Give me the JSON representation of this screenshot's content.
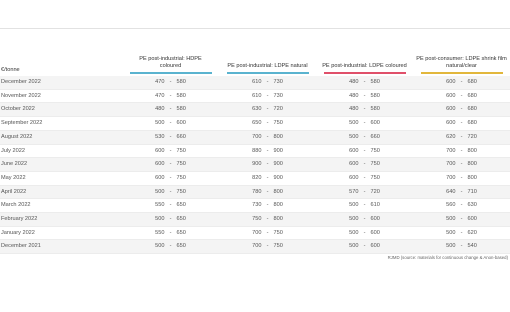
{
  "header_first": "€/tonne",
  "columns": [
    {
      "line1": "PE post-industrial: HDPE",
      "line2": "coloured",
      "color": "#5ab3cf"
    },
    {
      "line1": "PE post-industrial: LDPE natural",
      "line2": "",
      "color": "#5ab3cf"
    },
    {
      "line1": "PE post-industrial: LDPE coloured",
      "line2": "",
      "color": "#e0506a"
    },
    {
      "line1": "PE post-consumer: LDPE shrink film",
      "line2": "natural/clear",
      "color": "#e2b73c"
    }
  ],
  "separator": "-",
  "rows": [
    {
      "month": "December 2022",
      "ranges": [
        [
          "470",
          "580"
        ],
        [
          "610",
          "730"
        ],
        [
          "480",
          "580"
        ],
        [
          "600",
          "680"
        ]
      ]
    },
    {
      "month": "November 2022",
      "ranges": [
        [
          "470",
          "580"
        ],
        [
          "610",
          "730"
        ],
        [
          "480",
          "580"
        ],
        [
          "600",
          "680"
        ]
      ]
    },
    {
      "month": "October 2022",
      "ranges": [
        [
          "480",
          "580"
        ],
        [
          "630",
          "720"
        ],
        [
          "480",
          "580"
        ],
        [
          "600",
          "680"
        ]
      ]
    },
    {
      "month": "September 2022",
      "ranges": [
        [
          "500",
          "600"
        ],
        [
          "650",
          "750"
        ],
        [
          "500",
          "600"
        ],
        [
          "600",
          "680"
        ]
      ]
    },
    {
      "month": "August 2022",
      "ranges": [
        [
          "530",
          "660"
        ],
        [
          "700",
          "800"
        ],
        [
          "500",
          "660"
        ],
        [
          "620",
          "720"
        ]
      ]
    },
    {
      "month": "July 2022",
      "ranges": [
        [
          "600",
          "750"
        ],
        [
          "880",
          "900"
        ],
        [
          "600",
          "750"
        ],
        [
          "700",
          "800"
        ]
      ]
    },
    {
      "month": "June 2022",
      "ranges": [
        [
          "600",
          "750"
        ],
        [
          "900",
          "900"
        ],
        [
          "600",
          "750"
        ],
        [
          "700",
          "800"
        ]
      ]
    },
    {
      "month": "May 2022",
      "ranges": [
        [
          "600",
          "750"
        ],
        [
          "820",
          "900"
        ],
        [
          "600",
          "750"
        ],
        [
          "700",
          "800"
        ]
      ]
    },
    {
      "month": "April 2022",
      "ranges": [
        [
          "500",
          "750"
        ],
        [
          "780",
          "800"
        ],
        [
          "570",
          "720"
        ],
        [
          "640",
          "710"
        ]
      ]
    },
    {
      "month": "March 2022",
      "ranges": [
        [
          "550",
          "650"
        ],
        [
          "730",
          "800"
        ],
        [
          "500",
          "610"
        ],
        [
          "560",
          "630"
        ]
      ]
    },
    {
      "month": "February 2022",
      "ranges": [
        [
          "500",
          "650"
        ],
        [
          "750",
          "800"
        ],
        [
          "500",
          "600"
        ],
        [
          "500",
          "600"
        ]
      ]
    },
    {
      "month": "January 2022",
      "ranges": [
        [
          "550",
          "650"
        ],
        [
          "700",
          "750"
        ],
        [
          "500",
          "600"
        ],
        [
          "500",
          "620"
        ]
      ]
    },
    {
      "month": "December 2021",
      "ranges": [
        [
          "500",
          "650"
        ],
        [
          "700",
          "750"
        ],
        [
          "500",
          "600"
        ],
        [
          "500",
          "540"
        ]
      ]
    }
  ],
  "source": "RJMD (source: materials for continuous change & Anon-based)"
}
